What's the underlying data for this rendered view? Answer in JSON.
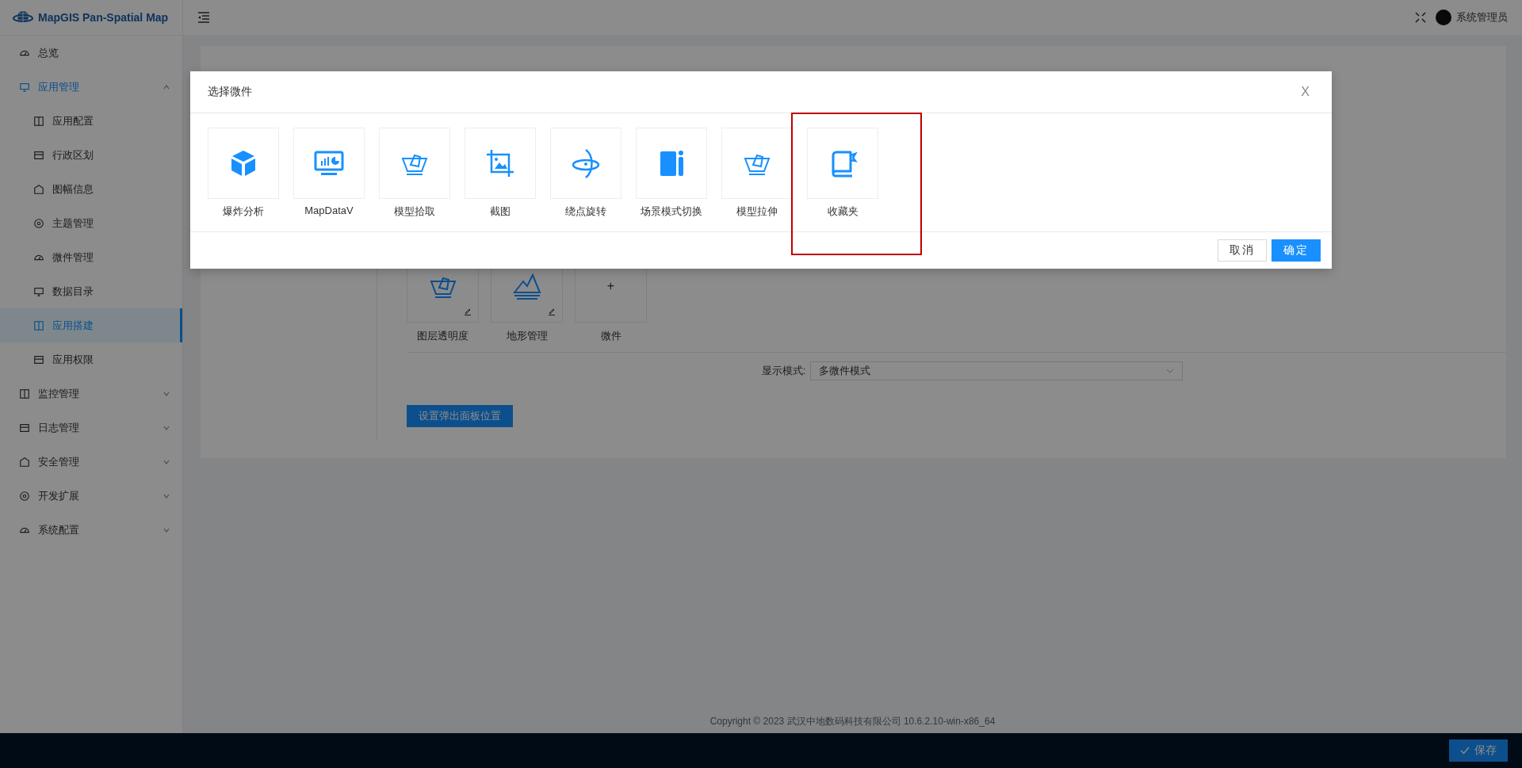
{
  "header": {
    "logo_text": "MapGIS Pan-Spatial Map",
    "user": "系统管理员"
  },
  "sidebar": {
    "items": [
      {
        "label": "总览",
        "kind": "link",
        "selected": false
      },
      {
        "label": "应用管理",
        "kind": "group",
        "expanded": true,
        "children": [
          {
            "label": "应用配置",
            "selected": false
          },
          {
            "label": "行政区划",
            "selected": false
          },
          {
            "label": "图幅信息",
            "selected": false
          },
          {
            "label": "主题管理",
            "selected": false
          },
          {
            "label": "微件管理",
            "selected": false
          },
          {
            "label": "数据目录",
            "selected": false
          },
          {
            "label": "应用搭建",
            "selected": true
          },
          {
            "label": "应用权限",
            "selected": false
          }
        ]
      },
      {
        "label": "监控管理",
        "kind": "group",
        "expanded": false
      },
      {
        "label": "日志管理",
        "kind": "group",
        "expanded": false
      },
      {
        "label": "安全管理",
        "kind": "group",
        "expanded": false
      },
      {
        "label": "开发扩展",
        "kind": "group",
        "expanded": false
      },
      {
        "label": "系统配置",
        "kind": "group",
        "expanded": false
      }
    ]
  },
  "content": {
    "widgets": [
      {
        "label": "图层透明度",
        "kind": "widget"
      },
      {
        "label": "地形管理",
        "kind": "widget"
      },
      {
        "label": "微件",
        "kind": "add",
        "symbol": "+"
      }
    ],
    "display_mode": {
      "label": "显示模式:",
      "value": "多微件模式"
    },
    "panel_button": "设置弹出面板位置"
  },
  "footer": {
    "copyright": "Copyright © 2023 武汉中地数码科技有限公司 10.6.2.10-win-x86_64"
  },
  "bottom_bar": {
    "save_button": "保存"
  },
  "dialog": {
    "title": "选择微件",
    "close": "X",
    "widgets": [
      {
        "label": "爆炸分析",
        "highlighted": false
      },
      {
        "label": "MapDataV",
        "highlighted": false
      },
      {
        "label": "模型拾取",
        "highlighted": false
      },
      {
        "label": "截图",
        "highlighted": false
      },
      {
        "label": "绕点旋转",
        "highlighted": false
      },
      {
        "label": "场景模式切换",
        "highlighted": false
      },
      {
        "label": "模型拉伸",
        "highlighted": false
      },
      {
        "label": "收藏夹",
        "highlighted": true
      }
    ],
    "buttons": [
      {
        "label": "取消",
        "kind": "secondary"
      },
      {
        "label": "确定",
        "kind": "primary"
      }
    ]
  }
}
